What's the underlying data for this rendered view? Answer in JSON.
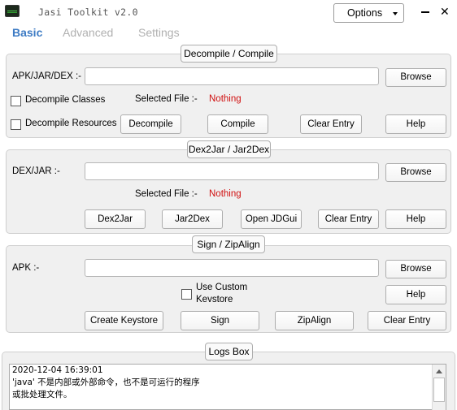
{
  "window": {
    "title": "Jasi Toolkit v2.0",
    "options_label": "Options",
    "minimize_label": "",
    "close_label": "✕"
  },
  "tabs": [
    {
      "label": "Basic",
      "active": true
    },
    {
      "label": "Advanced",
      "active": false
    },
    {
      "label": "Settings",
      "active": false
    }
  ],
  "decompile": {
    "title": "Decompile / Compile",
    "input_label": "APK/JAR/DEX :-",
    "input_value": "",
    "browse_label": "Browse",
    "decompile_classes_label": "Decompile Classes",
    "decompile_classes_checked": false,
    "decompile_resources_label": "Decompile Resources",
    "decompile_resources_checked": false,
    "selected_file_label": "Selected File :-",
    "selected_file_value": "Nothing",
    "decompile_button": "Decompile",
    "compile_button": "Compile",
    "clear_button": "Clear Entry",
    "help_button": "Help"
  },
  "dex2jar": {
    "title": "Dex2Jar / Jar2Dex",
    "input_label": "DEX/JAR :-",
    "input_value": "",
    "browse_label": "Browse",
    "selected_file_label": "Selected File :-",
    "selected_file_value": "Nothing",
    "dex2jar_button": "Dex2Jar",
    "jar2dex_button": "Jar2Dex",
    "jdgui_button": "Open JDGui",
    "clear_button": "Clear Entry",
    "help_button": "Help"
  },
  "sign": {
    "title": "Sign / ZipAlign",
    "input_label": "APK :-",
    "input_value": "",
    "browse_label": "Browse",
    "custom_keystore_line1": "Use Custom",
    "custom_keystore_line2": "Kevstore",
    "custom_keystore_checked": false,
    "help_button": "Help",
    "create_keystore_button": "Create Keystore",
    "sign_button": "Sign",
    "zipalign_button": "ZipAlign",
    "clear_button": "Clear Entry"
  },
  "logs": {
    "title": "Logs Box",
    "lines": [
      "2020-12-04 16:39:01",
      "'java' 不是内部或外部命令，也不是可运行的程序",
      "或批处理文件。"
    ]
  },
  "colors": {
    "accent": "#3d7bc4",
    "error": "#d01010",
    "panel": "#f0f0f0"
  }
}
